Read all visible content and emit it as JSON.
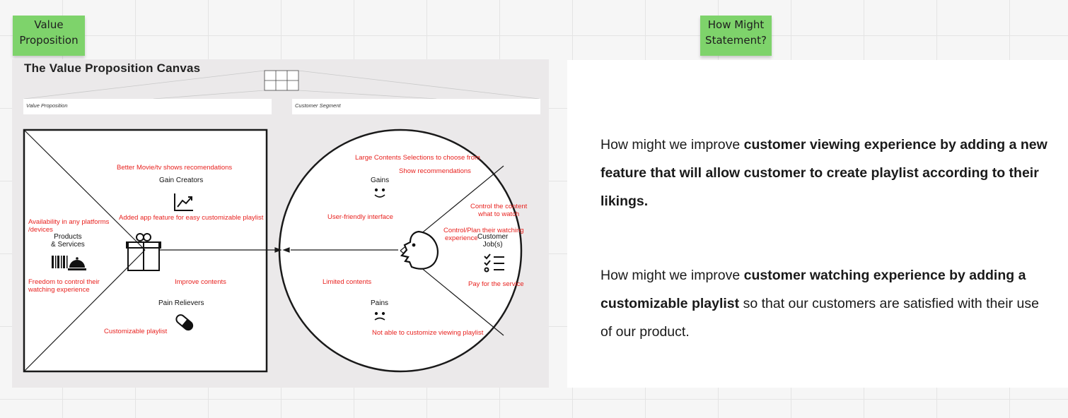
{
  "stickies": {
    "value_proposition": [
      "Value",
      "Proposition"
    ],
    "how_might": [
      "How Might",
      "Statement?"
    ]
  },
  "canvas": {
    "title": "The Value Proposition Canvas",
    "section_value_proposition": "Value Proposition",
    "section_customer_segment": "Customer Segment",
    "square": {
      "gain_creators": "Gain Creators",
      "products_services": [
        "Products",
        "& Services"
      ],
      "pain_relievers": "Pain Relievers",
      "notes": {
        "better_movie": "Better Movie/tv shows recomendations",
        "added_app_feature": "Added app feature for easy customizable  playlist",
        "availability": [
          "Availability in any  platforms",
          "/devices"
        ],
        "freedom": [
          "Freedom to control their",
          "watching experience"
        ],
        "improve_contents": "Improve  contents",
        "customizable_playlist": "Customizable playlist"
      }
    },
    "circle": {
      "gains": "Gains",
      "pains": "Pains",
      "customer_jobs": [
        "Customer",
        "Job(s)"
      ],
      "notes": {
        "large_contents": "Large Contents Selections to choose from",
        "show_recommendations": "Show recommendations",
        "user_friendly": "User-friendly interface",
        "control_content": [
          "Control the content",
          "what to watch"
        ],
        "control_plan": [
          "Control/Plan their watching",
          "experience"
        ],
        "limited_contents": "Limited contents",
        "pay_service": "Pay for the  service",
        "not_able": "Not able to customize viewing playlist"
      }
    }
  },
  "how_might_statements": [
    {
      "prefix": "How might we improve ",
      "bold": "customer viewing experience by adding a new feature that will allow customer to create playlist according to their likings.",
      "suffix": ""
    },
    {
      "prefix": "How might we improve ",
      "bold": "customer watching experience by adding a customizable playlist",
      "suffix": " so that our customers are satisfied with their use of our product."
    }
  ],
  "colors": {
    "sticky_green": "#7ed36b",
    "note_red": "#e8221f",
    "canvas_bg": "#ebe9ea"
  }
}
